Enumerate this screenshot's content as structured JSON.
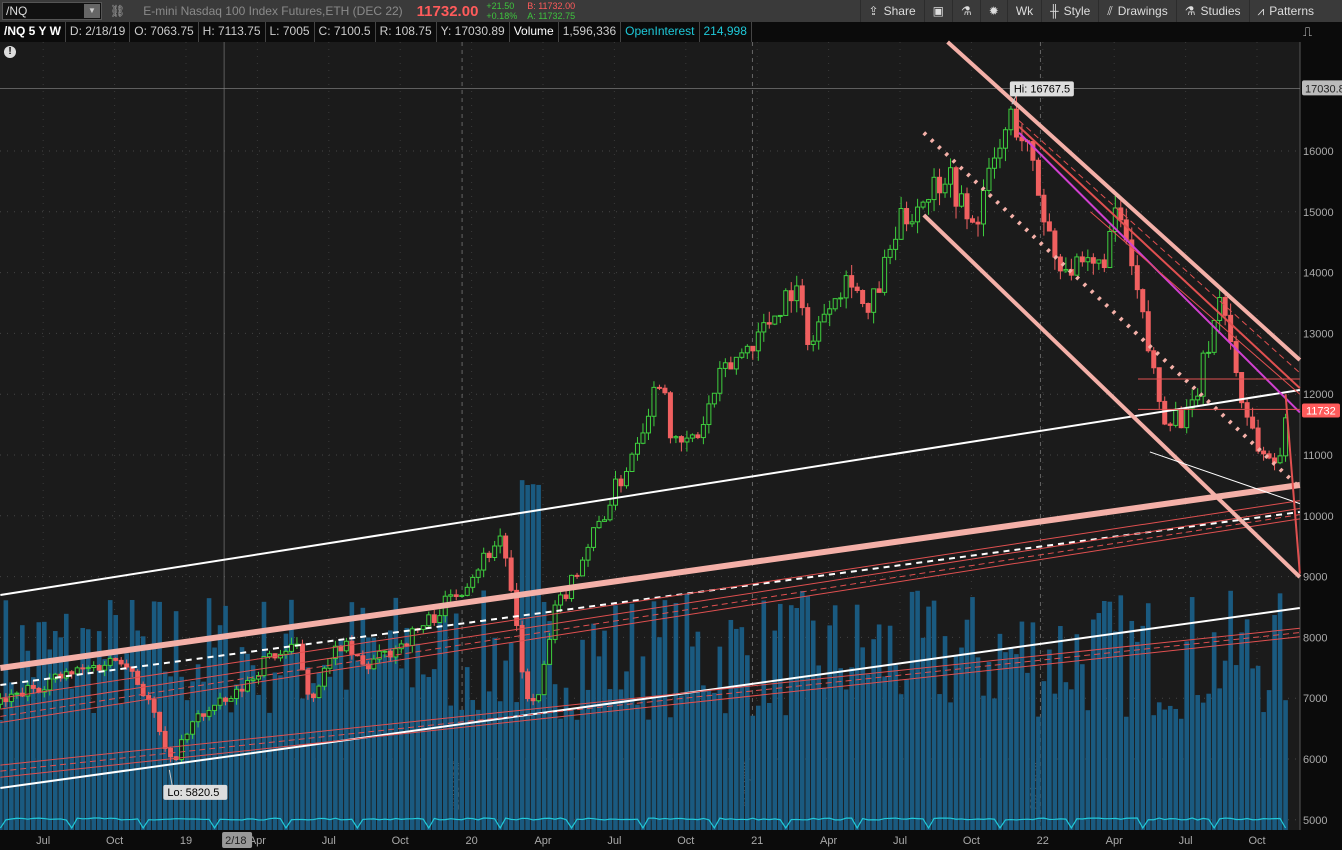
{
  "toolbar": {
    "symbol": "/NQ",
    "description": "E-mini Nasdaq 100 Index Futures,ETH (DEC 22)",
    "last": "11732.00",
    "change": "+21.50",
    "change_pct": "+0.18%",
    "bid": "B: 11732.00",
    "ask": "A: 11732.75",
    "buttons": [
      {
        "label": "Share",
        "icon": "share-icon"
      },
      {
        "label": "",
        "icon": "alert-icon"
      },
      {
        "label": "",
        "icon": "flask-icon"
      },
      {
        "label": "",
        "icon": "gear-icon"
      },
      {
        "label": "Wk",
        "icon": ""
      },
      {
        "label": "Style",
        "icon": "candle-icon"
      },
      {
        "label": "Drawings",
        "icon": "drawings-icon"
      },
      {
        "label": "Studies",
        "icon": "flask-icon"
      },
      {
        "label": "Patterns",
        "icon": "patterns-icon"
      }
    ]
  },
  "infobar": {
    "title": "/NQ 5 Y W",
    "date": "D: 2/18/19",
    "open": "O: 7063.75",
    "high": "H: 7113.75",
    "low": "L: 7005",
    "close": "C: 7100.5",
    "range": "R: 108.75",
    "y": "Y: 17030.89",
    "volume_label": "Volume",
    "volume": "1,596,336",
    "oi_label": "OpenInterest",
    "oi": "214,998"
  },
  "chart_data": {
    "type": "candlestick",
    "title": "/NQ 5 Y W",
    "ylim": [
      5000,
      17300
    ],
    "yticks": [
      16000,
      15000,
      14000,
      13000,
      12000,
      11000,
      10000,
      9000,
      8000,
      7000,
      6000,
      5000
    ],
    "xticks": [
      {
        "label": "Jul",
        "m": -6
      },
      {
        "label": "Oct",
        "m": -3
      },
      {
        "label": "19",
        "m": 0
      },
      {
        "label": "Apr",
        "m": 3
      },
      {
        "label": "Jul",
        "m": 6
      },
      {
        "label": "Oct",
        "m": 9
      },
      {
        "label": "20",
        "m": 12
      },
      {
        "label": "Apr",
        "m": 15
      },
      {
        "label": "Jul",
        "m": 18
      },
      {
        "label": "Oct",
        "m": 21
      },
      {
        "label": "21",
        "m": 24
      },
      {
        "label": "Apr",
        "m": 27
      },
      {
        "label": "Jul",
        "m": 30
      },
      {
        "label": "Oct",
        "m": 33
      },
      {
        "label": "22",
        "m": 36
      },
      {
        "label": "Apr",
        "m": 39
      },
      {
        "label": "Jul",
        "m": 42
      },
      {
        "label": "Oct",
        "m": 45
      }
    ],
    "year_markers": [
      {
        "label": "2019 year",
        "m": 11.6
      },
      {
        "label": "2020 year",
        "m": 23.8
      },
      {
        "label": "2021 year",
        "m": 35.9
      }
    ],
    "crosshair": {
      "label": "2/18",
      "m": 1.6,
      "price": 17030.8,
      "price_label": "17030.8"
    },
    "last_price": {
      "value": 11732,
      "label": "11732"
    },
    "hi": {
      "label": "Hi: 16767.5",
      "m": 34.7,
      "price": 16767.5
    },
    "lo": {
      "label": "Lo: 5820.5",
      "m": -0.7,
      "price": 5820.5
    },
    "price_path": [
      [
        -7.8,
        6900
      ],
      [
        -6,
        7250
      ],
      [
        -4,
        7500
      ],
      [
        -2.6,
        7700
      ],
      [
        -1.5,
        6900
      ],
      [
        -0.7,
        5900
      ],
      [
        0.5,
        6700
      ],
      [
        2,
        7000
      ],
      [
        3.5,
        7700
      ],
      [
        4.7,
        7800
      ],
      [
        5.2,
        7000
      ],
      [
        6.5,
        7900
      ],
      [
        7.5,
        7500
      ],
      [
        8.7,
        7800
      ],
      [
        10,
        8200
      ],
      [
        11.5,
        8800
      ],
      [
        13.3,
        9700
      ],
      [
        14.2,
        7200
      ],
      [
        14.7,
        6800
      ],
      [
        15.5,
        8400
      ],
      [
        17,
        9600
      ],
      [
        18.5,
        10800
      ],
      [
        20,
        12400
      ],
      [
        20.5,
        11100
      ],
      [
        21.5,
        11300
      ],
      [
        22.5,
        12300
      ],
      [
        24.5,
        13200
      ],
      [
        25.5,
        13800
      ],
      [
        26.3,
        12800
      ],
      [
        27,
        13600
      ],
      [
        28,
        14000
      ],
      [
        28.6,
        13200
      ],
      [
        30,
        14800
      ],
      [
        32,
        15700
      ],
      [
        33,
        14700
      ],
      [
        34.7,
        16600
      ],
      [
        35.3,
        16100
      ],
      [
        36.5,
        14300
      ],
      [
        37.5,
        14000
      ],
      [
        38.4,
        14100
      ],
      [
        39.2,
        15000
      ],
      [
        40.3,
        13000
      ],
      [
        41,
        11700
      ],
      [
        42.2,
        11600
      ],
      [
        43.5,
        13700
      ],
      [
        44.3,
        12000
      ],
      [
        45.2,
        11000
      ],
      [
        45.8,
        10900
      ],
      [
        46.4,
        11732
      ]
    ],
    "volume": {
      "min": 0,
      "note": "weekly volume bars, ~60-95% of panel"
    },
    "drawings": [
      {
        "kind": "line",
        "color": "#ffffff",
        "w": 2,
        "p": [
          [
            -7.8,
            8697
          ],
          [
            46.8,
            12069
          ]
        ]
      },
      {
        "kind": "line",
        "color": "#f4b0a8",
        "w": 6,
        "p": [
          [
            -7.8,
            7497
          ],
          [
            46.8,
            10507
          ]
        ]
      },
      {
        "kind": "line",
        "color": "#ffffff",
        "w": 2,
        "dash": "6,5",
        "p": [
          [
            -7.8,
            7217
          ],
          [
            46.8,
            10063
          ]
        ]
      },
      {
        "kind": "line",
        "color": "#e05050",
        "w": 1,
        "p": [
          [
            -7.8,
            7000
          ],
          [
            46.8,
            10250
          ]
        ]
      },
      {
        "kind": "line",
        "color": "#e05050",
        "w": 1,
        "p": [
          [
            -7.8,
            6820
          ],
          [
            46.8,
            10120
          ]
        ]
      },
      {
        "kind": "line",
        "color": "#e05050",
        "w": 1,
        "dash": "6,4",
        "p": [
          [
            -7.8,
            6700
          ],
          [
            46.8,
            10020
          ]
        ]
      },
      {
        "kind": "line",
        "color": "#e05050",
        "w": 1,
        "p": [
          [
            -7.8,
            6600
          ],
          [
            46.8,
            9950
          ]
        ]
      },
      {
        "kind": "line",
        "color": "#ffffff",
        "w": 2,
        "p": [
          [
            -7.8,
            5523
          ],
          [
            46.8,
            8484
          ]
        ]
      },
      {
        "kind": "line",
        "color": "#e05050",
        "w": 1,
        "p": [
          [
            -7.8,
            5900
          ],
          [
            46.8,
            8150
          ]
        ]
      },
      {
        "kind": "line",
        "color": "#e05050",
        "w": 1,
        "dash": "6,4",
        "p": [
          [
            -7.8,
            5800
          ],
          [
            46.8,
            8080
          ]
        ]
      },
      {
        "kind": "line",
        "color": "#e05050",
        "w": 1,
        "p": [
          [
            -7.8,
            5700
          ],
          [
            46.8,
            8010
          ]
        ]
      },
      {
        "kind": "line",
        "color": "#f4b0a8",
        "w": 4,
        "p": [
          [
            32,
            17793
          ],
          [
            46.8,
            12563
          ]
        ]
      },
      {
        "kind": "line",
        "color": "#f4b0a8",
        "w": 4,
        "p": [
          [
            31,
            14947
          ],
          [
            46.8,
            8993
          ]
        ]
      },
      {
        "kind": "line",
        "color": "#f4b0a8",
        "w": 4,
        "dash": "3,7",
        "p": [
          [
            31,
            16300
          ],
          [
            46.8,
            10460
          ]
        ]
      },
      {
        "kind": "line",
        "color": "#d040d0",
        "w": 2,
        "p": [
          [
            35,
            16300
          ],
          [
            46.8,
            11700
          ]
        ]
      },
      {
        "kind": "line",
        "color": "#e05050",
        "w": 2,
        "p": [
          [
            35,
            16400
          ],
          [
            46.8,
            12100
          ]
        ]
      },
      {
        "kind": "line",
        "color": "#e05050",
        "w": 1,
        "dash": "6,4",
        "p": [
          [
            35,
            16500
          ],
          [
            46.8,
            12350
          ]
        ]
      },
      {
        "kind": "line",
        "color": "#e05050",
        "w": 1,
        "p": [
          [
            38,
            15000
          ],
          [
            46.8,
            12000
          ]
        ]
      },
      {
        "kind": "line",
        "color": "#e05050",
        "w": 1,
        "p": [
          [
            40,
            12250
          ],
          [
            46.8,
            12250
          ]
        ]
      },
      {
        "kind": "line",
        "color": "#e05050",
        "w": 1,
        "p": [
          [
            40,
            11750
          ],
          [
            46.8,
            11750
          ]
        ]
      },
      {
        "kind": "line",
        "color": "#ffffff",
        "w": 1,
        "p": [
          [
            40.5,
            11050
          ],
          [
            46.8,
            10200
          ]
        ]
      },
      {
        "kind": "line",
        "color": "#e05050",
        "w": 2,
        "p": [
          [
            46.2,
            12000
          ],
          [
            46.8,
            9050
          ]
        ]
      }
    ]
  }
}
